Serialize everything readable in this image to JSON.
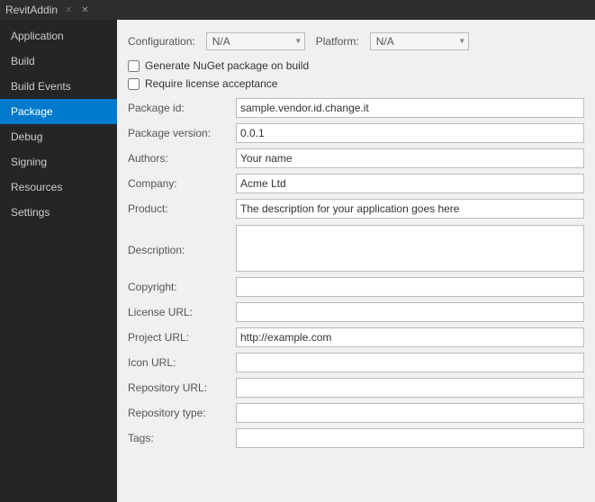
{
  "titleBar": {
    "tabName": "RevitAddin",
    "closeIcon": "✕"
  },
  "sidebar": {
    "items": [
      {
        "id": "application",
        "label": "Application",
        "active": false
      },
      {
        "id": "build",
        "label": "Build",
        "active": false
      },
      {
        "id": "build-events",
        "label": "Build Events",
        "active": false
      },
      {
        "id": "package",
        "label": "Package",
        "active": true
      },
      {
        "id": "debug",
        "label": "Debug",
        "active": false
      },
      {
        "id": "signing",
        "label": "Signing",
        "active": false
      },
      {
        "id": "resources",
        "label": "Resources",
        "active": false
      },
      {
        "id": "settings",
        "label": "Settings",
        "active": false
      }
    ]
  },
  "content": {
    "configuration": {
      "label": "Configuration:",
      "value": "N/A",
      "placeholder": "N/A"
    },
    "platform": {
      "label": "Platform:",
      "value": "N/A",
      "placeholder": "N/A"
    },
    "checkboxes": {
      "nuget": {
        "label": "Generate NuGet package on build",
        "checked": false
      },
      "license": {
        "label": "Require license acceptance",
        "checked": false
      }
    },
    "fields": [
      {
        "id": "package-id",
        "label": "Package id:",
        "value": "sample.vendor.id.change.it",
        "type": "text"
      },
      {
        "id": "package-version",
        "label": "Package version:",
        "value": "0.0.1",
        "type": "text"
      },
      {
        "id": "authors",
        "label": "Authors:",
        "value": "Your name",
        "type": "text"
      },
      {
        "id": "company",
        "label": "Company:",
        "value": "Acme Ltd",
        "type": "text"
      },
      {
        "id": "product",
        "label": "Product:",
        "value": "The description for your application goes here",
        "type": "text"
      },
      {
        "id": "description",
        "label": "Description:",
        "value": "",
        "type": "textarea"
      },
      {
        "id": "copyright",
        "label": "Copyright:",
        "value": "",
        "type": "text"
      },
      {
        "id": "license-url",
        "label": "License URL:",
        "value": "",
        "type": "text"
      },
      {
        "id": "project-url",
        "label": "Project URL:",
        "value": "http://example.com",
        "type": "text"
      },
      {
        "id": "icon-url",
        "label": "Icon URL:",
        "value": "",
        "type": "text"
      },
      {
        "id": "repository-url",
        "label": "Repository URL:",
        "value": "",
        "type": "text"
      },
      {
        "id": "repository-type",
        "label": "Repository type:",
        "value": "",
        "type": "text"
      },
      {
        "id": "tags",
        "label": "Tags:",
        "value": "",
        "type": "text"
      }
    ]
  }
}
